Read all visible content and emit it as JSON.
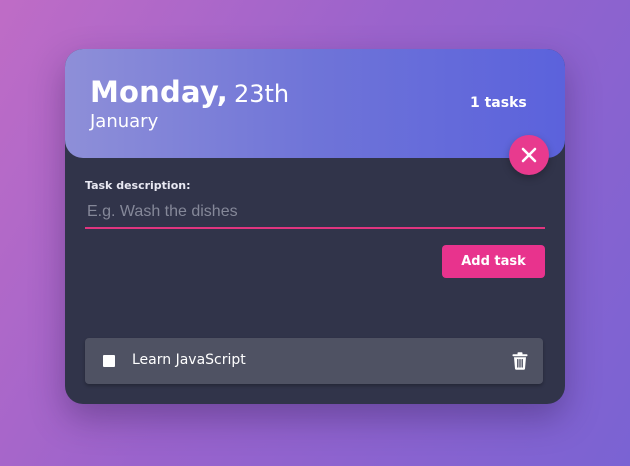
{
  "header": {
    "day_name": "Monday,",
    "day_number": "23th",
    "month": "January",
    "task_count": "1 tasks"
  },
  "form": {
    "label": "Task description:",
    "placeholder": "E.g. Wash the dishes",
    "value": "",
    "add_button_label": "Add task"
  },
  "tasks": [
    {
      "label": "Learn JavaScript",
      "done": false
    }
  ],
  "icons": {
    "close": "close-icon",
    "delete": "trash-icon"
  },
  "colors": {
    "accent": "#e8338d",
    "card_bg": "#31344a",
    "header_gradient_start": "#8e8fd8",
    "header_gradient_end": "#5b62dc",
    "task_bg": "#4f5263"
  }
}
